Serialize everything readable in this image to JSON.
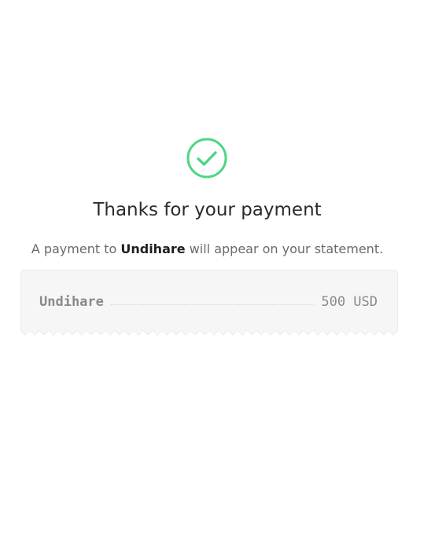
{
  "confirmation": {
    "icon": "check-circle-icon",
    "icon_color": "#4cd683",
    "title": "Thanks for your payment",
    "message_prefix": "A payment to ",
    "merchant_name": "Undihare",
    "message_suffix": " will appear on your statement."
  },
  "receipt": {
    "merchant": "Undihare",
    "amount": "500 USD"
  }
}
